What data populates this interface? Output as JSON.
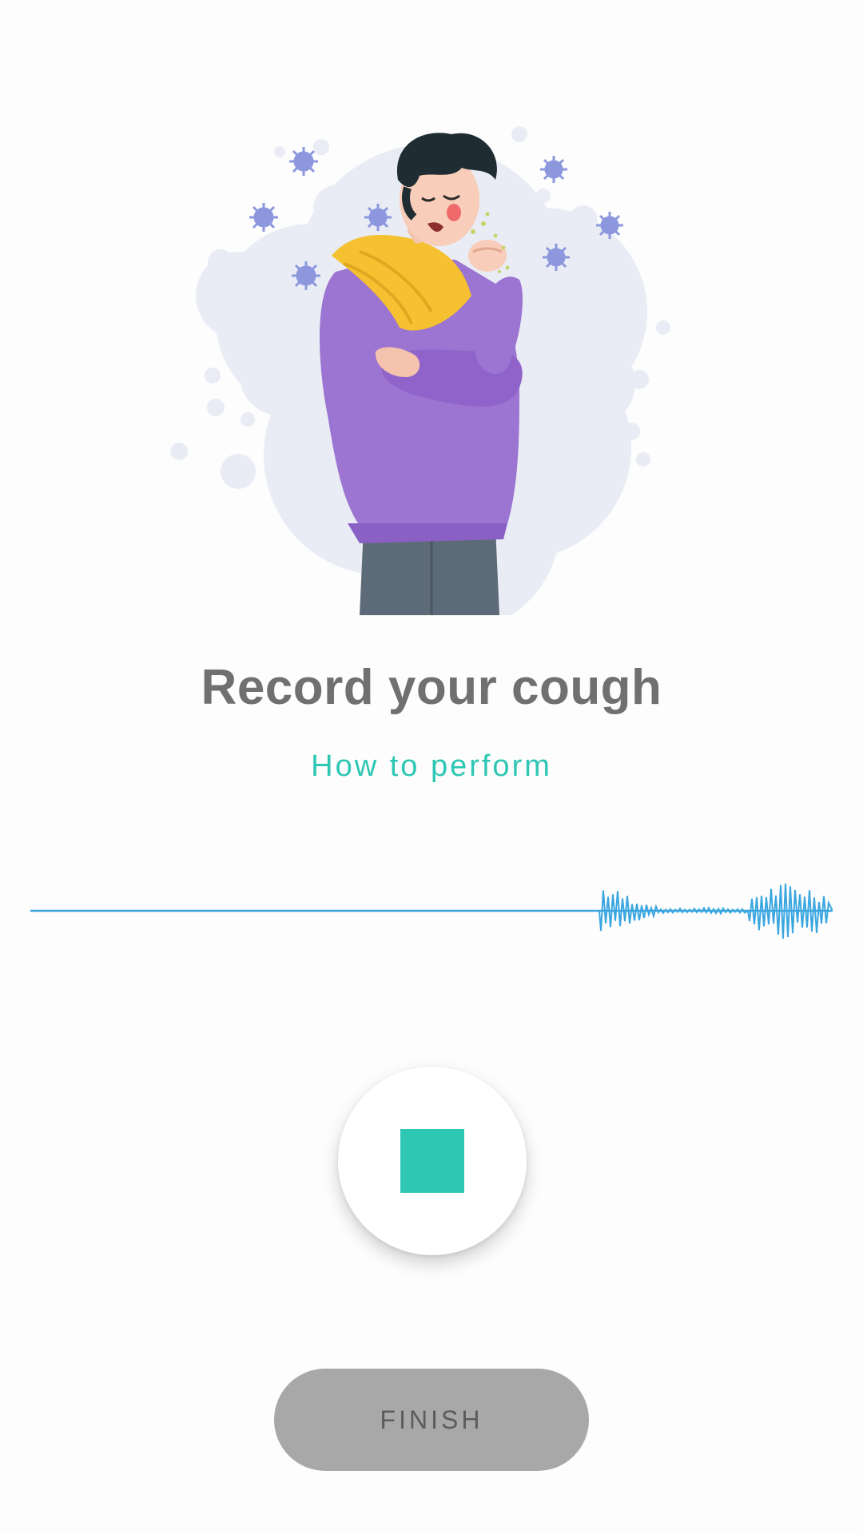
{
  "screen": {
    "title": "Record your cough",
    "how_to_link": "How to perform"
  },
  "illustration": {
    "icon": "person-coughing-illustration"
  },
  "recorder": {
    "waveform_icon": "audio-waveform",
    "button_icon": "stop-icon",
    "state": "recording"
  },
  "actions": {
    "finish_label": "FINISH",
    "finish_enabled": false
  },
  "colors": {
    "accent": "#2ec7b4",
    "waveform": "#3aa6e0",
    "title": "#707070",
    "finish_bg": "#a8a8a8",
    "finish_text": "#5c5c5c"
  }
}
